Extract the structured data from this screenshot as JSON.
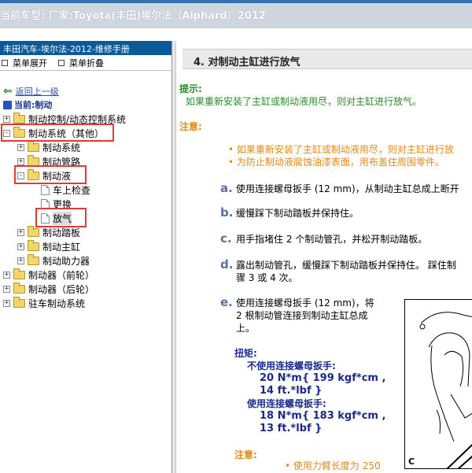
{
  "topbar": {
    "label": "当前车型:",
    "value": "厂家:Toyota(丰田)埃尔法（Alphard）2012"
  },
  "left": {
    "header": "丰田汽车-埃尔法-2012-维修手册",
    "expand_label": "菜单展开",
    "collapse_label": "菜单折叠",
    "back_label": "返回上一级",
    "current_label": "当前:制动",
    "tree": [
      {
        "label": "制动控制/动态控制系统",
        "pm": "+"
      },
      {
        "label": "制动系统（其他）",
        "pm": "-"
      },
      {
        "label": "制动系统",
        "pm": "+"
      },
      {
        "label": "制动管路",
        "pm": "+"
      },
      {
        "label": "制动液",
        "pm": "-"
      },
      {
        "label": "车上检查"
      },
      {
        "label": "更换"
      },
      {
        "label": "放气"
      },
      {
        "label": "制动踏板",
        "pm": "+"
      },
      {
        "label": "制动主缸",
        "pm": "+"
      },
      {
        "label": "制动助力器",
        "pm": "+"
      },
      {
        "label": "制动器（前轮）",
        "pm": "+"
      },
      {
        "label": "制动器（后轮）",
        "pm": "+"
      },
      {
        "label": "驻车制动系统",
        "pm": "+"
      }
    ],
    "highlight_color": "#e03a3a"
  },
  "content": {
    "section_title": "4. 对制动主缸进行放气",
    "hint_heading": "提示:",
    "hint_text": "如果重新安装了主缸或制动液用尽，则对主缸进行放气。",
    "caution_heading": "注意:",
    "caution_items": [
      "如果重新安装了主缸或制动液用尽，则对主缸进行放",
      "为防止制动液腐蚀油漆表面，用布盖住周围零件。"
    ],
    "steps": [
      {
        "letter": "a.",
        "lines": [
          "使用连接螺母扳手 (12 mm)，从制动主缸总成上断开"
        ]
      },
      {
        "letter": "b.",
        "lines": [
          "缓慢踩下制动踏板并保持住。"
        ]
      },
      {
        "letter": "c.",
        "lines": [
          "用手指堵住 2 个制动管孔，并松开制动踏板。"
        ]
      },
      {
        "letter": "d.",
        "lines": [
          "露出制动管孔，缓慢踩下制动踏板并保持住。 踩住制",
          "骤 3 或 4 次。"
        ]
      },
      {
        "letter": "e.",
        "lines": [
          "使用连接螺母扳手 (12 mm)，将",
          "2 根制动管连接到制动主缸总成",
          "上。"
        ]
      }
    ],
    "torque": {
      "heading": "扭矩:",
      "without_label": "不使用连接螺母扳手:",
      "without_v1": "20 N*m{ 199 kgf*cm ,",
      "without_v2": "14 ft.*lbf }",
      "with_label": "使用连接螺母扳手:",
      "with_v1": "18 N*m{ 183 kgf*cm ,",
      "with_v2": "13 ft.*lbf }"
    },
    "caution2_heading": "注意:",
    "caution2_item": "使用力臂长度为 250",
    "figure_label": "C",
    "colors": {
      "green": "#2a8a2a",
      "orange": "#e08a1a",
      "torque": "#1a2a8a"
    }
  }
}
